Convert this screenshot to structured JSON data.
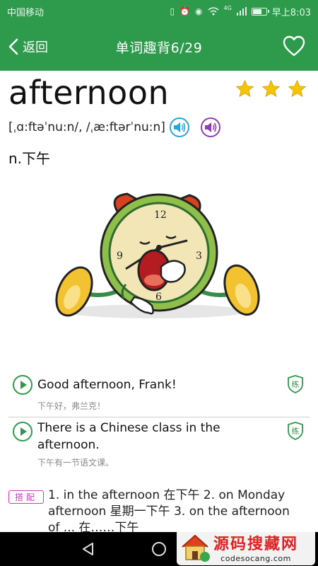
{
  "status_bar": {
    "carrier": "中国移动",
    "network": "4G",
    "time": "早上8:03"
  },
  "header": {
    "back_label": "返回",
    "title": "单词趣背6/29",
    "favorite_icon": "heart-outline-icon"
  },
  "word": {
    "text": "afternoon",
    "stars": 3,
    "star_color": "#f6c400",
    "phonetic": "[ˌɑ:ftəˈnu:n/, /ˌæ:ftərˈnu:n]",
    "meaning": "n.下午"
  },
  "sentences": [
    {
      "en": "Good afternoon, Frank!",
      "cn": "下午好，弗兰克！",
      "practice_label": "练"
    },
    {
      "en": "There is a Chinese class in the afternoon.",
      "cn": "下午有一节语文课。",
      "practice_label": "练"
    }
  ],
  "collocation": {
    "tag": "搭配",
    "text": "1. in the afternoon 在下午 2. on Monday afternoon 星期一下午 3. on the afternoon of ... 在……下午"
  },
  "watermark": {
    "title": "源码搜藏网",
    "url": "codesocang.com"
  },
  "colors": {
    "brand_green": "#2e9b4c",
    "uk_speaker": "#2aa6d6",
    "us_speaker": "#8e3fb6",
    "tag_magenta": "#cc3cb4"
  }
}
